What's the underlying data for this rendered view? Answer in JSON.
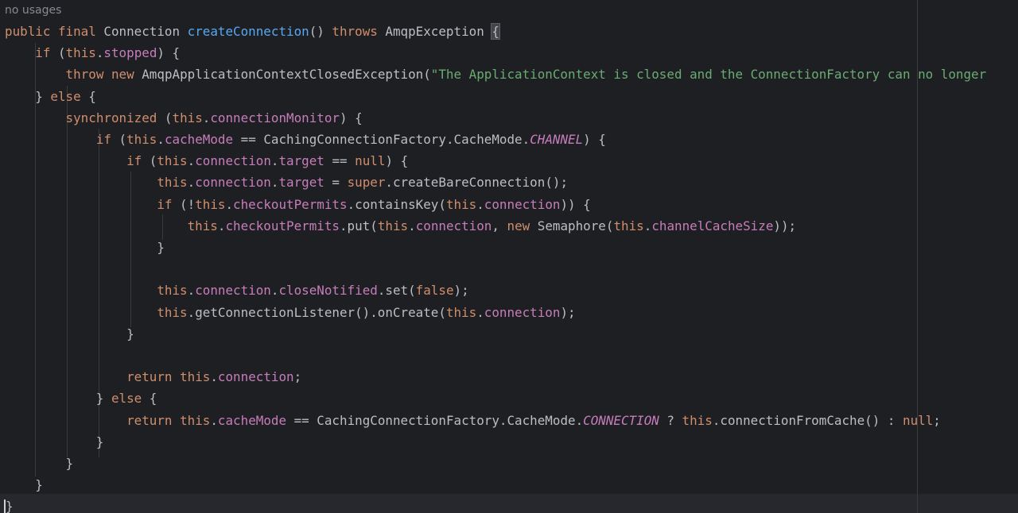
{
  "editor": {
    "usage_hint": "no usages",
    "lines": [
      [
        [
          "public",
          "kw"
        ],
        [
          " ",
          ""
        ],
        [
          "final",
          "kw"
        ],
        [
          " Connection ",
          ""
        ],
        [
          "createConnection",
          "fn"
        ],
        [
          "() ",
          ""
        ],
        [
          "throws",
          "kw"
        ],
        [
          " AmqpException ",
          ""
        ],
        [
          "{",
          "brace-hl"
        ]
      ],
      [
        [
          "    ",
          ""
        ],
        [
          "if",
          "kw"
        ],
        [
          " (",
          ""
        ],
        [
          "this",
          "kw"
        ],
        [
          ".",
          ""
        ],
        [
          "stopped",
          "fld"
        ],
        [
          ") {",
          ""
        ]
      ],
      [
        [
          "        ",
          ""
        ],
        [
          "throw",
          "kw"
        ],
        [
          " ",
          ""
        ],
        [
          "new",
          "kw"
        ],
        [
          " AmqpApplicationContextClosedException(",
          ""
        ],
        [
          "\"The ApplicationContext is closed and the ConnectionFactory can no longer",
          "str"
        ]
      ],
      [
        [
          "    } ",
          ""
        ],
        [
          "else",
          "kw"
        ],
        [
          " {",
          ""
        ]
      ],
      [
        [
          "        ",
          ""
        ],
        [
          "synchronized",
          "kw"
        ],
        [
          " (",
          ""
        ],
        [
          "this",
          "kw"
        ],
        [
          ".",
          ""
        ],
        [
          "connectionMonitor",
          "fld"
        ],
        [
          ") {",
          ""
        ]
      ],
      [
        [
          "            ",
          ""
        ],
        [
          "if",
          "kw"
        ],
        [
          " (",
          ""
        ],
        [
          "this",
          "kw"
        ],
        [
          ".",
          ""
        ],
        [
          "cacheMode",
          "fld"
        ],
        [
          " == CachingConnectionFactory.CacheMode.",
          ""
        ],
        [
          "CHANNEL",
          "fld it"
        ],
        [
          ") {",
          ""
        ]
      ],
      [
        [
          "                ",
          ""
        ],
        [
          "if",
          "kw"
        ],
        [
          " (",
          ""
        ],
        [
          "this",
          "kw"
        ],
        [
          ".",
          ""
        ],
        [
          "connection",
          "fld"
        ],
        [
          ".",
          ""
        ],
        [
          "target",
          "fld"
        ],
        [
          " == ",
          ""
        ],
        [
          "null",
          "kw"
        ],
        [
          ") {",
          ""
        ]
      ],
      [
        [
          "                    ",
          ""
        ],
        [
          "this",
          "kw"
        ],
        [
          ".",
          ""
        ],
        [
          "connection",
          "fld"
        ],
        [
          ".",
          ""
        ],
        [
          "target",
          "fld"
        ],
        [
          " = ",
          ""
        ],
        [
          "super",
          "kw"
        ],
        [
          ".createBareConnection();",
          ""
        ]
      ],
      [
        [
          "                    ",
          ""
        ],
        [
          "if",
          "kw"
        ],
        [
          " (!",
          ""
        ],
        [
          "this",
          "kw"
        ],
        [
          ".",
          ""
        ],
        [
          "checkoutPermits",
          "fld"
        ],
        [
          ".containsKey(",
          ""
        ],
        [
          "this",
          "kw"
        ],
        [
          ".",
          ""
        ],
        [
          "connection",
          "fld"
        ],
        [
          ")) {",
          ""
        ]
      ],
      [
        [
          "                        ",
          ""
        ],
        [
          "this",
          "kw"
        ],
        [
          ".",
          ""
        ],
        [
          "checkoutPermits",
          "fld"
        ],
        [
          ".put(",
          ""
        ],
        [
          "this",
          "kw"
        ],
        [
          ".",
          ""
        ],
        [
          "connection",
          "fld"
        ],
        [
          ", ",
          ""
        ],
        [
          "new",
          "kw"
        ],
        [
          " Semaphore(",
          ""
        ],
        [
          "this",
          "kw"
        ],
        [
          ".",
          ""
        ],
        [
          "channelCacheSize",
          "fld"
        ],
        [
          "));",
          ""
        ]
      ],
      [
        [
          "                    }",
          ""
        ]
      ],
      [
        [
          "",
          ""
        ]
      ],
      [
        [
          "                    ",
          ""
        ],
        [
          "this",
          "kw"
        ],
        [
          ".",
          ""
        ],
        [
          "connection",
          "fld"
        ],
        [
          ".",
          ""
        ],
        [
          "closeNotified",
          "fld"
        ],
        [
          ".set(",
          ""
        ],
        [
          "false",
          "kw"
        ],
        [
          ");",
          ""
        ]
      ],
      [
        [
          "                    ",
          ""
        ],
        [
          "this",
          "kw"
        ],
        [
          ".getConnectionListener().onCreate(",
          ""
        ],
        [
          "this",
          "kw"
        ],
        [
          ".",
          ""
        ],
        [
          "connection",
          "fld"
        ],
        [
          ");",
          ""
        ]
      ],
      [
        [
          "                }",
          ""
        ]
      ],
      [
        [
          "",
          ""
        ]
      ],
      [
        [
          "                ",
          ""
        ],
        [
          "return",
          "kw"
        ],
        [
          " ",
          ""
        ],
        [
          "this",
          "kw"
        ],
        [
          ".",
          ""
        ],
        [
          "connection",
          "fld"
        ],
        [
          ";",
          ""
        ]
      ],
      [
        [
          "            } ",
          ""
        ],
        [
          "else",
          "kw"
        ],
        [
          " {",
          ""
        ]
      ],
      [
        [
          "                ",
          ""
        ],
        [
          "return",
          "kw"
        ],
        [
          " ",
          ""
        ],
        [
          "this",
          "kw"
        ],
        [
          ".",
          ""
        ],
        [
          "cacheMode",
          "fld"
        ],
        [
          " == CachingConnectionFactory.CacheMode.",
          ""
        ],
        [
          "CONNECTION",
          "fld it"
        ],
        [
          " ? ",
          ""
        ],
        [
          "this",
          "kw"
        ],
        [
          ".connectionFromCache() : ",
          ""
        ],
        [
          "null",
          "kw"
        ],
        [
          ";",
          ""
        ]
      ],
      [
        [
          "            }",
          ""
        ]
      ],
      [
        [
          "        }",
          ""
        ]
      ],
      [
        [
          "    }",
          ""
        ]
      ],
      [
        [
          "}",
          "last"
        ]
      ]
    ]
  }
}
